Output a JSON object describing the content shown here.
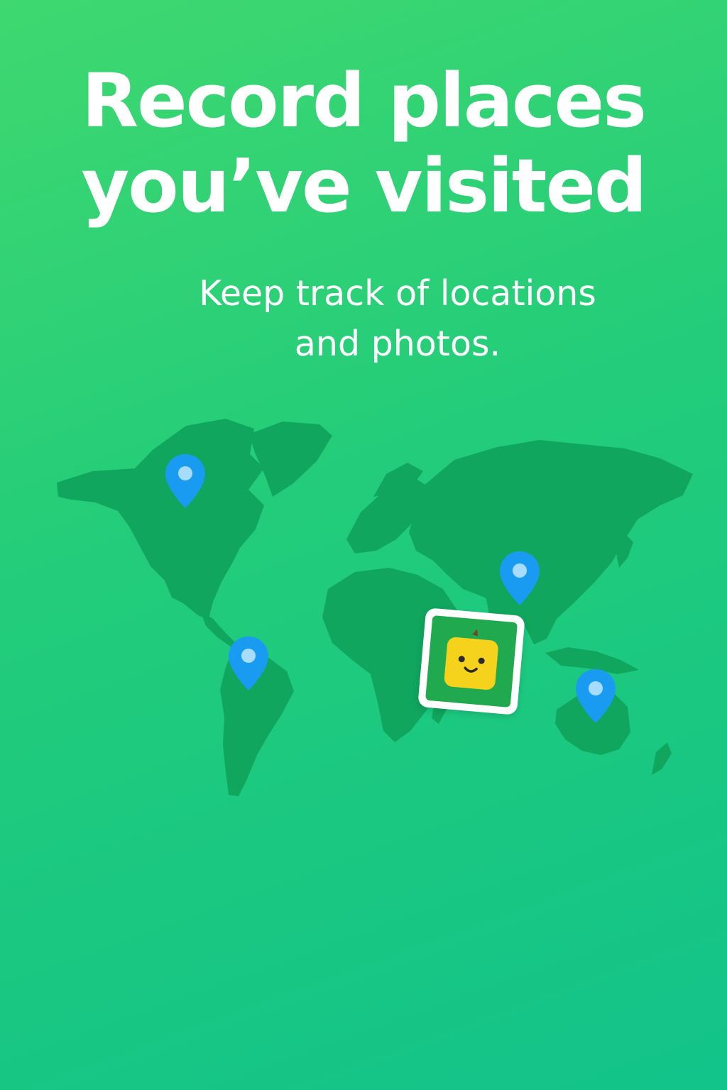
{
  "colors": {
    "bg_start": "#3fd870",
    "bg_mid": "#22cc7a",
    "bg_end": "#12c38a",
    "land": "#10a65e",
    "pin": "#1a9bf2",
    "pin_dot": "#a8dcff",
    "photo_bg": "#20a94e",
    "mascot": "#f5d21c"
  },
  "headline": {
    "line1": "Record places",
    "line2": "you’ve visited"
  },
  "subtitle": {
    "line1": "Keep track of locations",
    "line2": "and photos."
  },
  "map": {
    "icon": "world-map",
    "pins": [
      {
        "name": "location-pin-north-america-icon",
        "icon": "map-pin"
      },
      {
        "name": "location-pin-china-icon",
        "icon": "map-pin"
      },
      {
        "name": "location-pin-south-america-icon",
        "icon": "map-pin"
      },
      {
        "name": "location-pin-australia-icon",
        "icon": "map-pin"
      }
    ],
    "photo": {
      "icon": "smiling-mascot-photo"
    }
  }
}
